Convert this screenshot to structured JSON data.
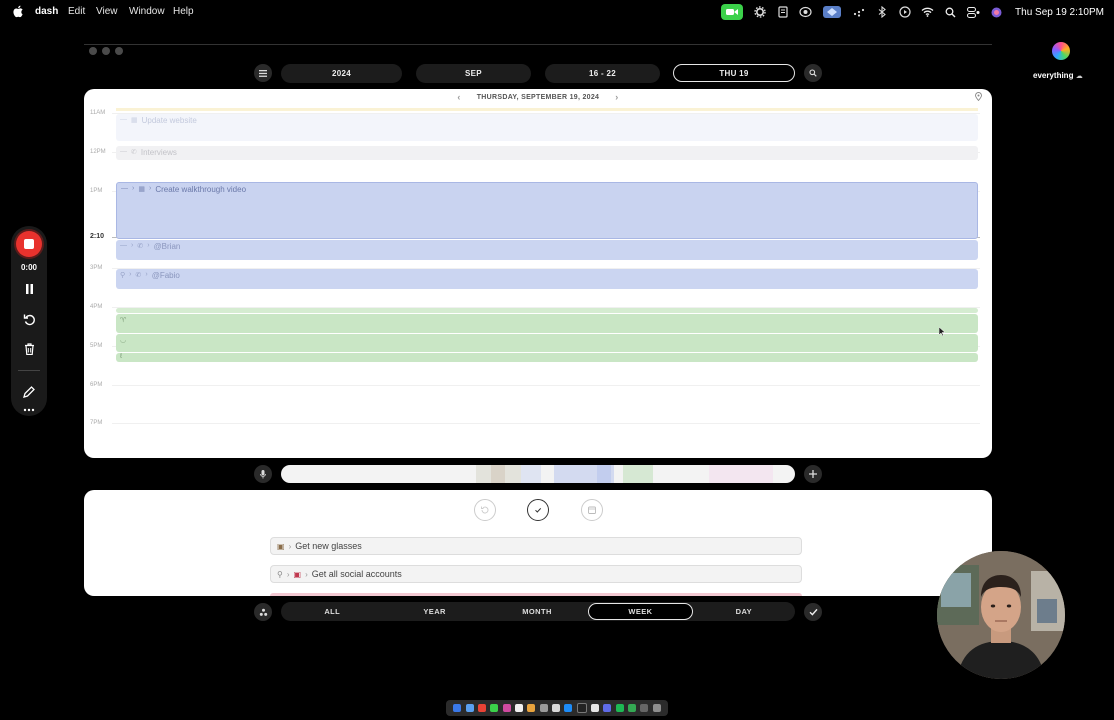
{
  "menubar": {
    "app_name": "dash",
    "menus": [
      "Edit",
      "View",
      "Window",
      "Help"
    ],
    "clock": "Thu Sep 19  2:10PM",
    "status_icons": [
      "facetime-icon",
      "gear-icon",
      "document-icon",
      "airdrop-icon",
      "vpn-icon",
      "dots-icon",
      "bluetooth-icon",
      "play-icon",
      "wifi-icon",
      "search-icon",
      "control-center-icon",
      "siri-icon"
    ]
  },
  "top_nav": {
    "year": "2024",
    "month": "SEP",
    "week_range": "16 - 22",
    "day": "THU 19"
  },
  "calendar": {
    "date_title": "THURSDAY, SEPTEMBER 19, 2024",
    "hours": [
      "11AM",
      "12PM",
      "1PM",
      "3PM",
      "4PM",
      "5PM",
      "6PM",
      "7PM"
    ],
    "now_label": "2:10",
    "events": [
      {
        "title": "Update website"
      },
      {
        "title": "Interviews"
      },
      {
        "title": "Create walkthrough video"
      },
      {
        "title": "@Brian"
      },
      {
        "title": "@Fabio"
      }
    ]
  },
  "tasks": {
    "items": [
      {
        "title": "Get new glasses"
      },
      {
        "title": "Get all social accounts"
      }
    ]
  },
  "views": {
    "items": [
      "ALL",
      "YEAR",
      "MONTH",
      "WEEK",
      "DAY"
    ],
    "active": "WEEK"
  },
  "recorder": {
    "time": "0:00"
  },
  "workspace": {
    "label": "everything"
  },
  "colors": {
    "event_blue": "#c9d3f0",
    "event_green": "#c9e6c5",
    "record_red": "#e8322d"
  }
}
